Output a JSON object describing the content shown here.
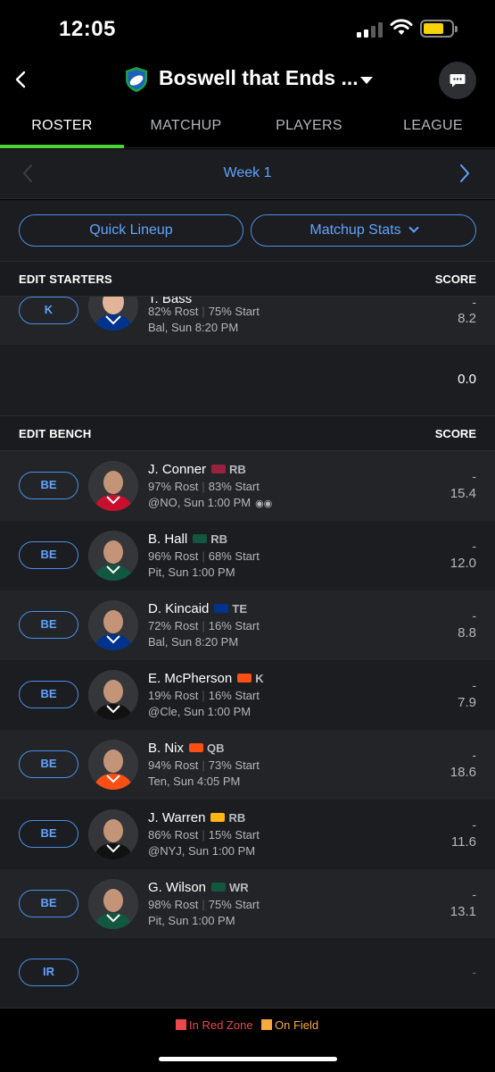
{
  "status": {
    "time": "12:05"
  },
  "header": {
    "title": "Boswell that Ends ...",
    "icons": [
      "back-chevron-icon",
      "football-shield-icon",
      "dropdown-caret-icon",
      "chat-bubble-icon"
    ]
  },
  "tabs": [
    {
      "label": "ROSTER",
      "active": true
    },
    {
      "label": "MATCHUP",
      "active": false
    },
    {
      "label": "PLAYERS",
      "active": false
    },
    {
      "label": "LEAGUE",
      "active": false
    }
  ],
  "week_nav": {
    "label": "Week 1"
  },
  "actions": {
    "quick_lineup": "Quick Lineup",
    "matchup_stats": "Matchup Stats"
  },
  "starters": {
    "header": "EDIT STARTERS",
    "score_header": "SCORE",
    "kicker": {
      "slot": "K",
      "name": "T. Bass",
      "rost": "82% Rost",
      "start": "75% Start",
      "game": "Bal, Sun 8:20 PM",
      "dash": "-",
      "score": "8.2"
    },
    "total": "0.0"
  },
  "bench": {
    "header": "EDIT BENCH",
    "score_header": "SCORE",
    "players": [
      {
        "slot": "BE",
        "name": "J. Conner",
        "pos": "RB",
        "team_color": "#97233f",
        "rost": "97% Rost",
        "start": "83% Start",
        "game": "@NO, Sun 1:00 PM",
        "game_icon": "binoculars-icon",
        "dash": "-",
        "score": "15.4",
        "jersey": "#c8102e"
      },
      {
        "slot": "BE",
        "name": "B. Hall",
        "pos": "RB",
        "team_color": "#125740",
        "rost": "96% Rost",
        "start": "68% Start",
        "game": "Pit, Sun 1:00 PM",
        "dash": "-",
        "score": "12.0",
        "jersey": "#125740"
      },
      {
        "slot": "BE",
        "name": "D. Kincaid",
        "pos": "TE",
        "team_color": "#00338d",
        "rost": "72% Rost",
        "start": "16% Start",
        "game": "Bal, Sun 8:20 PM",
        "dash": "-",
        "score": "8.8",
        "jersey": "#00338d"
      },
      {
        "slot": "BE",
        "name": "E. McPherson",
        "pos": "K",
        "team_color": "#fb4f14",
        "rost": "19% Rost",
        "start": "16% Start",
        "game": "@Cle, Sun 1:00 PM",
        "dash": "-",
        "score": "7.9",
        "jersey": "#111111"
      },
      {
        "slot": "BE",
        "name": "B. Nix",
        "pos": "QB",
        "team_color": "#fb4f14",
        "rost": "94% Rost",
        "start": "73% Start",
        "game": "Ten, Sun 4:05 PM",
        "dash": "-",
        "score": "18.6",
        "jersey": "#fb4f14"
      },
      {
        "slot": "BE",
        "name": "J. Warren",
        "pos": "RB",
        "team_color": "#ffb612",
        "rost": "86% Rost",
        "start": "15% Start",
        "game": "@NYJ, Sun 1:00 PM",
        "dash": "-",
        "score": "11.6",
        "jersey": "#111111"
      },
      {
        "slot": "BE",
        "name": "G. Wilson",
        "pos": "WR",
        "team_color": "#125740",
        "rost": "98% Rost",
        "start": "75% Start",
        "game": "Pit, Sun 1:00 PM",
        "dash": "-",
        "score": "13.1",
        "jersey": "#125740"
      }
    ],
    "ir": {
      "slot": "IR",
      "dash": "-"
    }
  },
  "legend": {
    "red_zone": "In Red Zone",
    "on_field": "On Field",
    "red_zone_color": "#e8474c",
    "on_field_color": "#f7a940"
  },
  "colors": {
    "accent_blue": "#5fa3ff",
    "active_tab": "#4cd137",
    "background": "#000000"
  }
}
